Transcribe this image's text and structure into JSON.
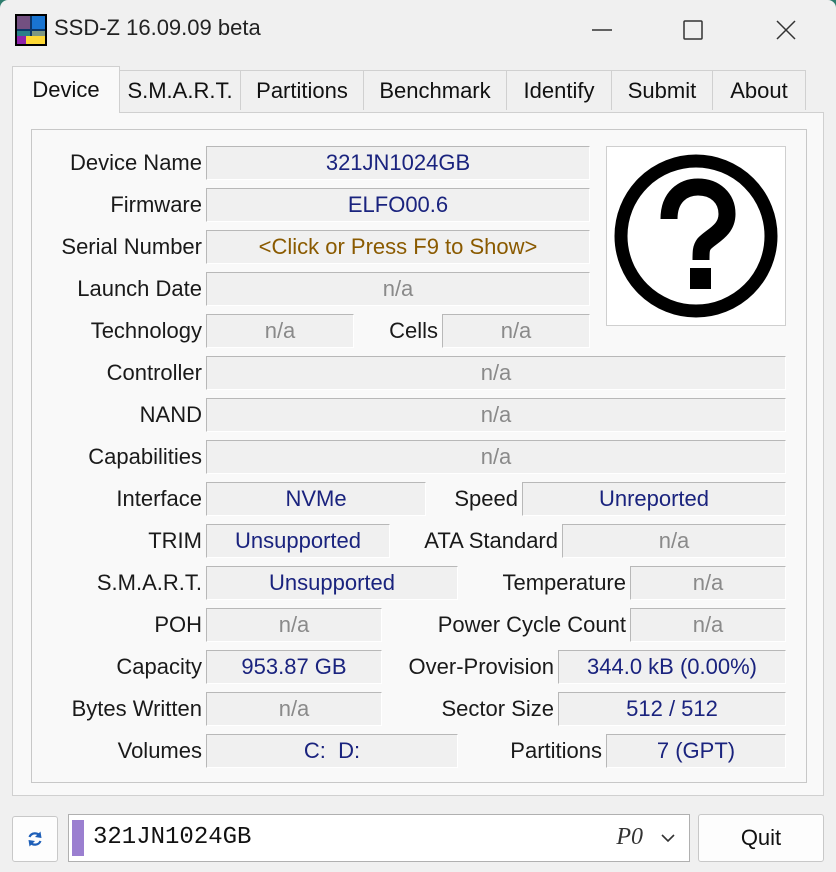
{
  "window": {
    "title": "SSD-Z 16.09.09 beta"
  },
  "tabs": [
    "Device",
    "S.M.A.R.T.",
    "Partitions",
    "Benchmark",
    "Identify",
    "Submit",
    "About"
  ],
  "device": {
    "device_name": {
      "label": "Device Name",
      "value": "321JN1024GB"
    },
    "firmware": {
      "label": "Firmware",
      "value": "ELFO00.6"
    },
    "serial_number": {
      "label": "Serial Number",
      "value": "<Click or Press F9 to Show>"
    },
    "launch_date": {
      "label": "Launch Date",
      "value": "n/a"
    },
    "technology": {
      "label": "Technology",
      "value": "n/a"
    },
    "cells": {
      "label": "Cells",
      "value": "n/a"
    },
    "controller": {
      "label": "Controller",
      "value": "n/a"
    },
    "nand": {
      "label": "NAND",
      "value": "n/a"
    },
    "capabilities": {
      "label": "Capabilities",
      "value": "n/a"
    },
    "interface": {
      "label": "Interface",
      "value": "NVMe"
    },
    "speed": {
      "label": "Speed",
      "value": "Unreported"
    },
    "trim": {
      "label": "TRIM",
      "value": "Unsupported"
    },
    "ata_standard": {
      "label": "ATA Standard",
      "value": "n/a"
    },
    "smart": {
      "label": "S.M.A.R.T.",
      "value": "Unsupported"
    },
    "temperature": {
      "label": "Temperature",
      "value": "n/a"
    },
    "poh": {
      "label": "POH",
      "value": "n/a"
    },
    "power_cycle_count": {
      "label": "Power Cycle Count",
      "value": "n/a"
    },
    "capacity": {
      "label": "Capacity",
      "value": "953.87 GB"
    },
    "over_provision": {
      "label": "Over-Provision",
      "value": "344.0 kB (0.00%)"
    },
    "bytes_written": {
      "label": "Bytes Written",
      "value": "n/a"
    },
    "sector_size": {
      "label": "Sector Size",
      "value": "512 / 512"
    },
    "volumes": {
      "label": "Volumes",
      "value": "C:  D:"
    },
    "partitions": {
      "label": "Partitions",
      "value": "7 (GPT)"
    }
  },
  "bottom": {
    "drive_name": "321JN1024GB",
    "drive_port": "P0",
    "quit_label": "Quit"
  },
  "colors": {
    "value_blue": "#1a237e",
    "value_gray": "#8a8a8a",
    "value_brown": "#8a5a00",
    "drive_accent": "#9b7fd0"
  }
}
